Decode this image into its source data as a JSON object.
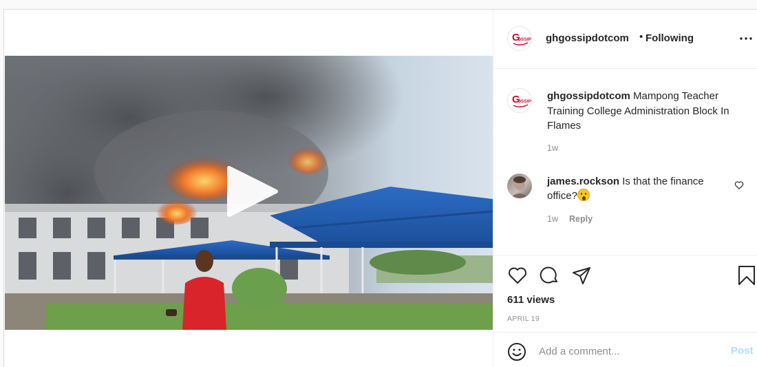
{
  "author": {
    "username": "ghgossipdotcom",
    "separator": "•",
    "follow_status": "Following",
    "avatar_logo_text": "GOSSIP"
  },
  "caption": {
    "username": "ghgossipdotcom",
    "text": "Mampong Teacher Training College Administration Block In Flames",
    "time": "1w"
  },
  "comments": [
    {
      "username": "james.rockson",
      "text": "Is that the finance office?",
      "emoji": "astonished-face",
      "time": "1w",
      "reply_label": "Reply"
    }
  ],
  "stats": {
    "views": "611 views",
    "date": "APRIL 19"
  },
  "add_comment": {
    "placeholder": "Add a comment...",
    "post_label": "Post"
  },
  "icons": {
    "more": "more-options-icon",
    "like": "heart-icon",
    "comment": "comment-bubble-icon",
    "share": "paper-plane-icon",
    "save": "bookmark-icon",
    "emoji": "emoji-icon",
    "play": "play-icon",
    "mute": "muted-speaker-icon"
  },
  "colors": {
    "brand_red": "#c8102e",
    "post_button_disabled": "#b2dffc",
    "secondary_text": "#8e8e8e"
  }
}
